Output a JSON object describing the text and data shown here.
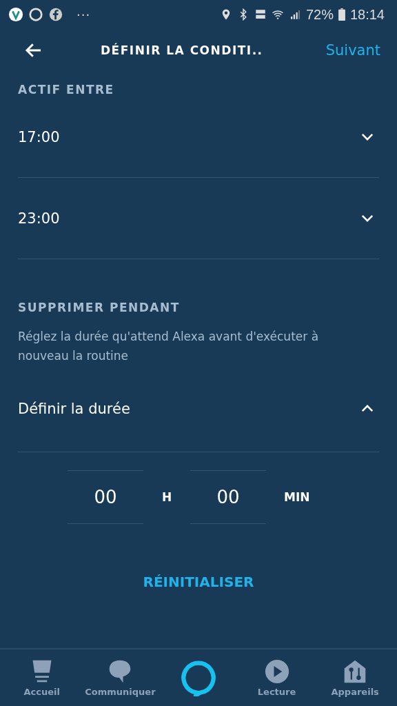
{
  "status_bar": {
    "battery": "72%",
    "time": "18:14",
    "more": "···"
  },
  "header": {
    "title": "DÉFINIR LA CONDITI..",
    "action": "Suivant"
  },
  "active_between": {
    "heading": "ACTIF ENTRE",
    "times": [
      {
        "value": "17:00",
        "expanded": false
      },
      {
        "value": "23:00",
        "expanded": false
      }
    ]
  },
  "suppress": {
    "heading": "SUPPRIMER PENDANT",
    "description": "Réglez la durée qu'attend Alexa avant d'exécuter à nouveau la routine",
    "duration": {
      "label": "Définir la durée",
      "expanded": true
    },
    "hours": "00",
    "hours_unit": "H",
    "minutes": "00",
    "minutes_unit": "MIN"
  },
  "reset": "RÉINITIALISER",
  "nav": [
    {
      "kind": "home",
      "label": "Accueil"
    },
    {
      "kind": "chat",
      "label": "Communiquer"
    },
    {
      "kind": "alexa"
    },
    {
      "kind": "play",
      "label": "Lecture"
    },
    {
      "kind": "devices",
      "label": "Appareils"
    }
  ]
}
